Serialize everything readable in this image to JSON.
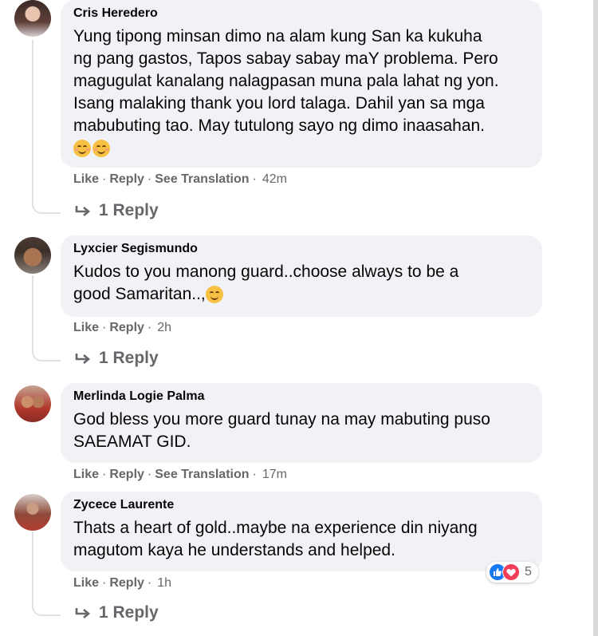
{
  "comments": [
    {
      "author": "Cris Heredero",
      "lines": [
        "Yung tipong minsan dimo na alam kung San ka kukuha",
        "ng pang gastos, Tapos sabay sabay maY problema. Pero",
        "magugulat kanalang nalagpasan muna pala lahat ng yon.",
        "Isang malaking thank you lord talaga. Dahil yan sa mga",
        "mabubuting tao. May tutulong sayo ng dimo inaasahan."
      ],
      "like": "Like",
      "reply": "Reply",
      "see_translation": "See Translation",
      "time": "42m",
      "replies": "1 Reply"
    },
    {
      "author": "Lyxcier Segismundo",
      "lines": [
        "Kudos to you manong guard..choose always to be a",
        "good Samaritan..,"
      ],
      "like": "Like",
      "reply": "Reply",
      "time": "2h",
      "replies": "1 Reply"
    },
    {
      "author": "Merlinda Logie Palma",
      "lines": [
        "God bless you more guard tunay na may mabuting puso",
        "SAEAMAT GID."
      ],
      "like": "Like",
      "reply": "Reply",
      "see_translation": "See Translation",
      "time": "17m"
    },
    {
      "author": "Zycece Laurente",
      "lines": [
        "Thats a heart of gold..maybe na experience din niyang",
        "magutom kaya he understands and helped."
      ],
      "like": "Like",
      "reply": "Reply",
      "time": "1h",
      "reaction_count": "5",
      "replies": "1 Reply"
    }
  ],
  "colors": {
    "bubble": "#f0f2f5",
    "meta": "#65676b",
    "like": "#1877f2",
    "love": "#f33e58"
  },
  "icons": [
    "smile-emoji",
    "reply-arrow-icon",
    "like-reaction-icon",
    "love-reaction-icon"
  ]
}
